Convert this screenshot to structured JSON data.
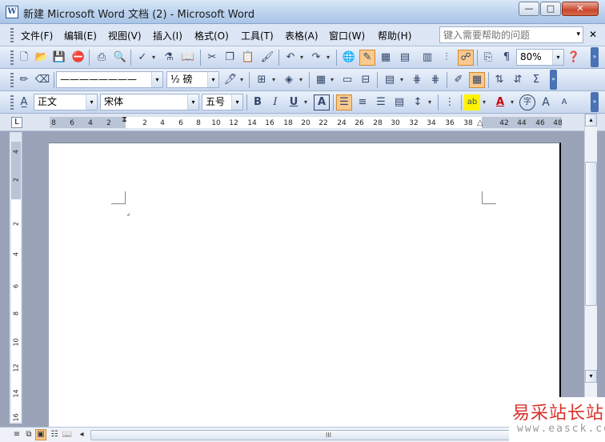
{
  "window": {
    "icon_label": "W",
    "title": "新建 Microsoft Word 文档 (2) - Microsoft Word",
    "min_label": "—",
    "max_label": "□",
    "close_label": "✕"
  },
  "menubar": {
    "items": [
      "文件(F)",
      "编辑(E)",
      "视图(V)",
      "插入(I)",
      "格式(O)",
      "工具(T)",
      "表格(A)",
      "窗口(W)",
      "帮助(H)"
    ],
    "help_placeholder": "键入需要帮助的问题",
    "help_arrow": "▾",
    "close_doc": "✕"
  },
  "standard_toolbar": {
    "icons": [
      "new-icon",
      "open-icon",
      "save-icon",
      "permission-icon",
      "print-icon",
      "print-preview-icon",
      "spelling-icon",
      "research-icon",
      "cut-icon",
      "copy-icon",
      "paste-icon",
      "format-painter-icon",
      "undo-icon",
      "redo-icon",
      "hyperlink-icon",
      "tables-borders-icon",
      "insert-table-icon",
      "insert-excel-icon",
      "columns-icon",
      "drawing-icon",
      "document-map-icon",
      "show-hide-icon",
      "read-icon",
      "help-icon"
    ],
    "zoom": "80%"
  },
  "tables_toolbar": {
    "line_style": "————————",
    "line_weight": "½ 磅"
  },
  "format_toolbar": {
    "style": "正文",
    "font": "宋体",
    "size": "五号",
    "bold": "B",
    "italic": "I",
    "underline": "U",
    "char_border": "A",
    "highlight": "ab",
    "font_color": "A",
    "enclose": "字",
    "grow": "A",
    "shrink": "A"
  },
  "ruler": {
    "corner": "L",
    "ticks": [
      "8",
      "6",
      "4",
      "2",
      "2",
      "4",
      "6",
      "8",
      "10",
      "12",
      "14",
      "16",
      "18",
      "20",
      "22",
      "24",
      "26",
      "28",
      "30",
      "32",
      "34",
      "36",
      "38",
      "42",
      "44",
      "46",
      "48"
    ],
    "vticks": [
      "4",
      "2",
      "2",
      "4",
      "6",
      "8",
      "10",
      "12",
      "14",
      "16"
    ]
  },
  "scrollbar": {
    "grip": "III",
    "left_arrow": "◂",
    "up_arrow": "▴",
    "down_arrow": "▾"
  },
  "view_buttons": [
    "normal-view-icon",
    "web-layout-icon",
    "print-layout-icon",
    "outline-view-icon",
    "reading-layout-icon"
  ],
  "watermark": {
    "cn": "易采站长站",
    "url": "www.easck.com"
  }
}
